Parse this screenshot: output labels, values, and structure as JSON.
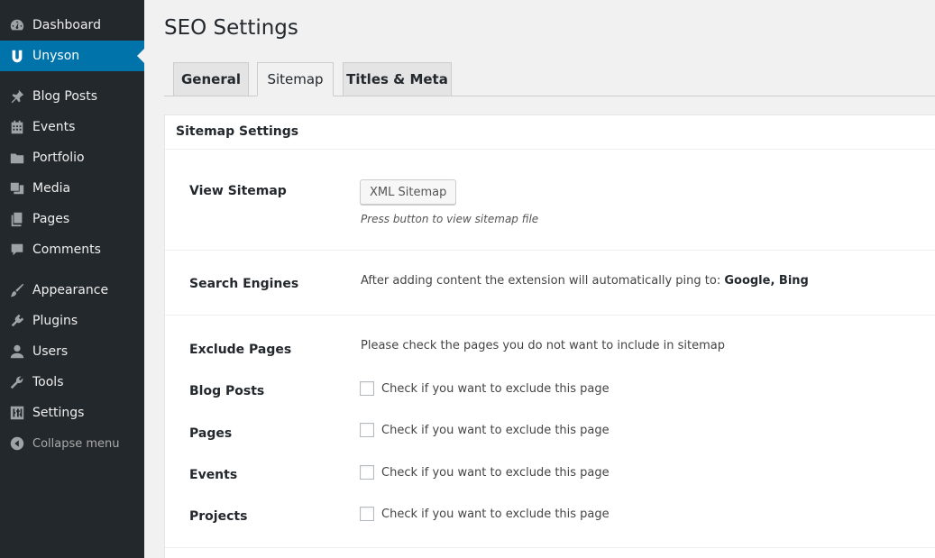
{
  "sidebar": {
    "items": [
      {
        "label": "Dashboard",
        "icon": "dashboard-icon"
      },
      {
        "label": "Unyson",
        "icon": "unyson-icon",
        "active": true
      },
      {
        "label": "Blog Posts",
        "icon": "pushpin-icon"
      },
      {
        "label": "Events",
        "icon": "calendar-icon"
      },
      {
        "label": "Portfolio",
        "icon": "folder-icon"
      },
      {
        "label": "Media",
        "icon": "media-icon"
      },
      {
        "label": "Pages",
        "icon": "pages-icon"
      },
      {
        "label": "Comments",
        "icon": "comment-icon"
      },
      {
        "label": "Appearance",
        "icon": "brush-icon"
      },
      {
        "label": "Plugins",
        "icon": "plugin-icon"
      },
      {
        "label": "Users",
        "icon": "user-icon"
      },
      {
        "label": "Tools",
        "icon": "wrench-icon"
      },
      {
        "label": "Settings",
        "icon": "settings-icon"
      }
    ],
    "collapse_label": "Collapse menu"
  },
  "page": {
    "title": "SEO Settings"
  },
  "tabs": [
    {
      "label": "General"
    },
    {
      "label": "Sitemap",
      "active": true
    },
    {
      "label": "Titles & Meta"
    }
  ],
  "panel": {
    "heading": "Sitemap Settings",
    "view_sitemap": {
      "label": "View Sitemap",
      "button": "XML Sitemap",
      "hint": "Press button to view sitemap file"
    },
    "search_engines": {
      "label": "Search Engines",
      "text": "After adding content the extension will automatically ping to: ",
      "engines": "Google, Bing"
    },
    "exclude": {
      "label": "Exclude Pages",
      "text": "Please check the pages you do not want to include in sitemap",
      "items": [
        {
          "label": "Blog Posts",
          "checkbox_label": "Check if you want to exclude this page",
          "checked": false
        },
        {
          "label": "Pages",
          "checkbox_label": "Check if you want to exclude this page",
          "checked": false
        },
        {
          "label": "Events",
          "checkbox_label": "Check if you want to exclude this page",
          "checked": false
        },
        {
          "label": "Projects",
          "checkbox_label": "Check if you want to exclude this page",
          "checked": false
        }
      ]
    }
  },
  "colors": {
    "sidebar_bg": "#23282d",
    "accent": "#0073aa",
    "page_bg": "#f1f1f1"
  }
}
